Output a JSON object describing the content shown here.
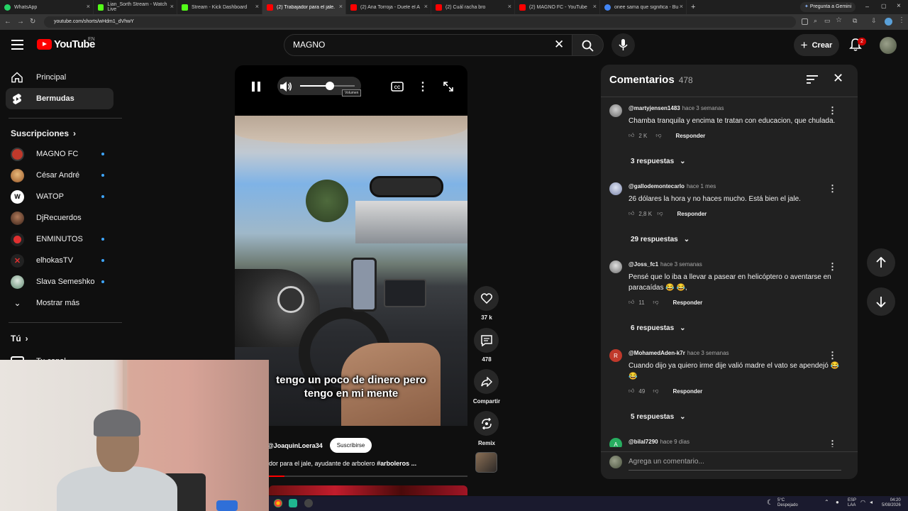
{
  "browser": {
    "tabs": [
      {
        "label": "WhatsApp",
        "color": "#25d366"
      },
      {
        "label": "Lian_Sorth Stream - Watch Live",
        "color": "#53fc18"
      },
      {
        "label": "Stream - Kick Dashboard",
        "color": "#53fc18"
      },
      {
        "label": "(2) Trabajador para el jale...",
        "color": "#ff0000",
        "active": true
      },
      {
        "label": "(2) Ana Torroja - Duele el A...",
        "color": "#ff0000"
      },
      {
        "label": "(2) Cuál racha bro",
        "color": "#ff0000"
      },
      {
        "label": "(2) MAGNO FC - YouTube",
        "color": "#ff0000"
      },
      {
        "label": "onee sama que significa - Busc...",
        "color": "#4285f4"
      }
    ],
    "gemini_label": "Pregunta a Gemini",
    "url": "youtube.com/shorts/wHdm1_dVhwY"
  },
  "header": {
    "logo_text": "YouTube",
    "region": "EN",
    "search_value": "MAGNO",
    "create_label": "Crear",
    "notifications_count": "2"
  },
  "sidebar": {
    "items": [
      {
        "label": "Principal"
      },
      {
        "label": "Bermudas"
      }
    ],
    "subscriptions_heading": "Suscripciones",
    "subscriptions": [
      {
        "label": "MAGNO FC",
        "color": "#c0392b",
        "new": true
      },
      {
        "label": "César André",
        "color": "#d4a04a",
        "new": true
      },
      {
        "label": "WATOP",
        "color": "#ffffff",
        "new": true
      },
      {
        "label": "DjRecuerdos",
        "color": "#7a4b3a",
        "new": false
      },
      {
        "label": "ENMINUTOS",
        "color": "#e03030",
        "new": true
      },
      {
        "label": "elhokasTV",
        "color": "#333333",
        "new": true
      },
      {
        "label": "Slava Semeshko",
        "color": "#8fb3a0",
        "new": true
      }
    ],
    "show_more_label": "Mostrar más",
    "you_heading": "Tú",
    "your_channel_label": "Tu canal"
  },
  "player": {
    "volume_level": 0.55,
    "volume_tooltip": "Volumen",
    "caption_line1": "tengo un poco de dinero pero",
    "caption_line2": "tengo en mi mente",
    "channel_handle": "@JoaquinLoera34",
    "subscribe_label": "Suscribirse",
    "description": "dor para el jale, ayudante de arbolero",
    "description_tag": "#arboleros ...",
    "progress": 0.08
  },
  "actions": {
    "likes": "37 k",
    "comments": "478",
    "share_label": "Compartir",
    "remix_label": "Remix"
  },
  "comments": {
    "title": "Comentarios",
    "count": "478",
    "add_placeholder": "Agrega un comentario...",
    "items": [
      {
        "user": "@martyjensen1483",
        "time": "hace 3 semanas",
        "text": "Chamba tranquila y encima te tratan con educacion, que chulada.",
        "likes": "2 K",
        "reply_label": "Responder",
        "replies": "3 respuestas",
        "avatar_color": "#888888",
        "avatar_letter": ""
      },
      {
        "user": "@gallodemontecarlo",
        "time": "hace 1 mes",
        "text": "26 dólares la hora y no haces mucho. Está bien el jale.",
        "likes": "2,8 K",
        "reply_label": "Responder",
        "replies": "29 respuestas",
        "avatar_color": "#9aa3c0",
        "avatar_letter": ""
      },
      {
        "user": "@Joss_fc1",
        "time": "hace 3 semanas",
        "text": "Pensé que lo iba a llevar a pasear en helicóptero o aventarse en paracaídas 😂 😂,",
        "likes": "11",
        "reply_label": "Responder",
        "replies": "6 respuestas",
        "avatar_color": "#b0b0b0",
        "avatar_letter": ""
      },
      {
        "user": "@MohamedAden-k7r",
        "time": "hace 3 semanas",
        "text": "Cuando dijo ya quiero irme dije valió madre el vato se apendejó 😂 😂",
        "likes": "49",
        "reply_label": "Responder",
        "replies": "5 respuestas",
        "avatar_color": "#c0392b",
        "avatar_letter": "R"
      },
      {
        "user": "@bilal7290",
        "time": "hace 9 días",
        "text": "",
        "likes": "",
        "reply_label": "",
        "replies": "",
        "avatar_color": "#27ae60",
        "avatar_letter": "A"
      }
    ]
  },
  "taskbar": {
    "weather_temp": "5°C",
    "weather_desc": "Despejado",
    "lang1": "ESP",
    "lang2": "LAA",
    "time": "04:20",
    "date": "5/08/2026"
  }
}
